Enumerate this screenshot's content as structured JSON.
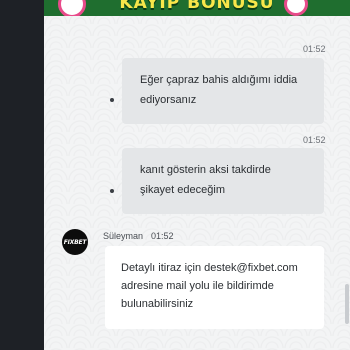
{
  "banner": {
    "title": "KAYIP BONUSU"
  },
  "messages": [
    {
      "time": "01:52",
      "lines": [
        "Eğer çapraz bahis aldığımı iddia",
        "ediyorsanız"
      ]
    },
    {
      "time": "01:52",
      "lines": [
        "kanıt gösterin aksi takdirde",
        "şikayet edeceğim"
      ]
    },
    {
      "sender": "Süleyman",
      "time": "01:52",
      "avatar_text": "FIXBET",
      "lines": [
        "Detaylı itiraz için destek@fixbet.com",
        "adresine mail yolu ile bildirimde",
        "bulunabilirsiniz"
      ]
    }
  ],
  "colors": {
    "banner_bg": "#1f6e2f",
    "banner_text": "#f8e64a",
    "agent_bubble": "#ffffff",
    "user_bubble": "#e4e6e8"
  }
}
